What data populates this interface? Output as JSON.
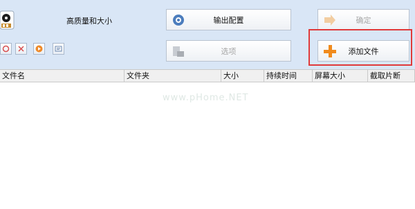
{
  "toolbar": {
    "preset_label": "高质量和大小",
    "buttons": {
      "output_config": "输出配置",
      "confirm": "确定",
      "options": "选项",
      "add_file": "添加文件"
    }
  },
  "table": {
    "columns": [
      "文件名",
      "文件夹",
      "大小",
      "持续时间",
      "屏幕大小",
      "截取片断"
    ]
  },
  "watermark": "www.pHome.NET",
  "colors": {
    "toolbar_bg": "#d9e6f6",
    "highlight_border": "#e03a3a",
    "add_icon": "#f08a1c"
  }
}
